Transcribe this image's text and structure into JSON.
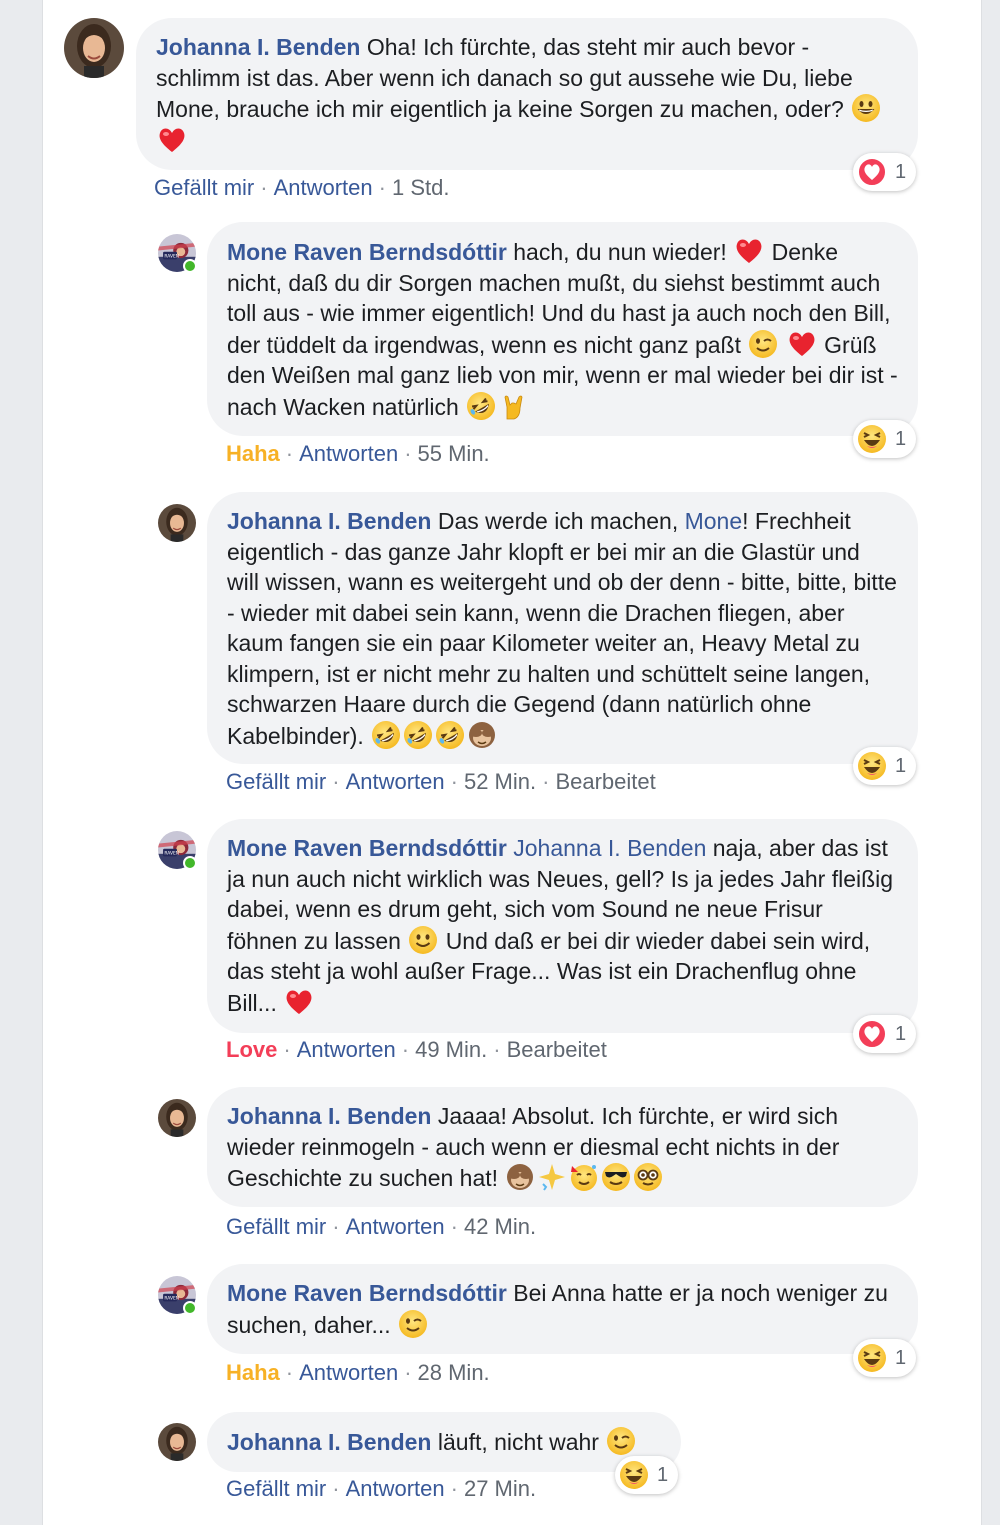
{
  "comments": [
    {
      "author": "Johanna I. Benden",
      "text": "Oha! Ich fürchte, das steht mir auch bevor - schlimm ist das. Aber wenn ich danach so gut aussehe wie Du, liebe Mone, brauche ich mir eigentlich ja keine Sorgen zu machen, oder?",
      "like_label": "Gefällt mir",
      "reply_label": "Antworten",
      "time": "1 Std.",
      "reaction_count": "1"
    },
    {
      "author": "Mone Raven Berndsdóttir",
      "text_a": "hach, du nun wieder!",
      "text_b": "Denke nicht, daß du dir Sorgen machen mußt, du siehst bestimmt auch toll aus - wie immer eigentlich! Und du hast ja auch noch den Bill, der tüddelt da irgendwas, wenn es nicht ganz paßt",
      "text_c": "Grüß den Weißen mal ganz lieb von mir, wenn er mal wieder bei dir ist - nach Wacken natürlich",
      "like_label": "Haha",
      "reply_label": "Antworten",
      "time": "55 Min.",
      "reaction_count": "1"
    },
    {
      "author": "Johanna I. Benden",
      "text_a": "Das werde ich machen,",
      "mention": "Mone",
      "text_b": "! Frechheit eigentlich - das ganze Jahr klopft er bei mir an die Glastür und will wissen, wann es weitergeht und ob der denn - bitte, bitte, bitte - wieder mit dabei sein kann, wenn die Drachen fliegen, aber kaum fangen sie ein paar Kilometer weiter an, Heavy Metal zu klimpern, ist er nicht mehr zu halten und schüttelt seine langen, schwarzen Haare durch die Gegend (dann natürlich ohne Kabelbinder).",
      "like_label": "Gefällt mir",
      "reply_label": "Antworten",
      "time": "52 Min.",
      "edited": "Bearbeitet",
      "reaction_count": "1"
    },
    {
      "author": "Mone Raven Berndsdóttir",
      "mention": "Johanna I. Benden",
      "text_a": "naja, aber das ist ja nun auch nicht wirklich was Neues, gell? Is ja jedes Jahr fleißig dabei, wenn es drum geht, sich vom Sound ne neue Frisur föhnen zu lassen",
      "text_b": "Und daß er bei dir wieder dabei sein wird, das steht ja wohl außer Frage... Was ist ein Drachenflug ohne Bill...",
      "like_label": "Love",
      "reply_label": "Antworten",
      "time": "49 Min.",
      "edited": "Bearbeitet",
      "reaction_count": "1"
    },
    {
      "author": "Johanna I. Benden",
      "text": "Jaaaa! Absolut. Ich fürchte, er wird sich wieder reinmogeln - auch wenn er diesmal echt nichts in der Geschichte zu suchen hat!",
      "like_label": "Gefällt mir",
      "reply_label": "Antworten",
      "time": "42 Min."
    },
    {
      "author": "Mone Raven Berndsdóttir",
      "text": "Bei Anna hatte er ja noch weniger zu suchen, daher...",
      "like_label": "Haha",
      "reply_label": "Antworten",
      "time": "28 Min.",
      "reaction_count": "1"
    },
    {
      "author": "Johanna I. Benden",
      "text": "läuft, nicht wahr",
      "like_label": "Gefällt mir",
      "reply_label": "Antworten",
      "time": "27 Min.",
      "reaction_count": "1"
    }
  ],
  "colors": {
    "author": "#385898",
    "haha": "#f7b125",
    "love": "#f33e58",
    "bubble": "#f2f3f5",
    "online": "#42b72a"
  }
}
